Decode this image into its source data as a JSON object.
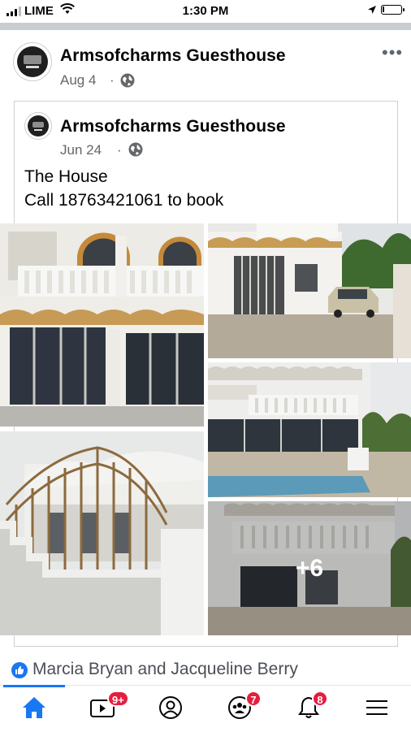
{
  "status_bar": {
    "carrier": "LIME",
    "time": "1:30 PM"
  },
  "post": {
    "page_name": "Armsofcharms Guesthouse",
    "date": "Aug 4",
    "meta_separator": "·",
    "more_menu": "•••"
  },
  "shared_post": {
    "page_name": "Armsofcharms Guesthouse",
    "date": "Jun 24",
    "meta_separator": "·",
    "text_line1": "The House",
    "text_line2": "Call 18763421061 to book",
    "more_photos": "+6"
  },
  "reactions": {
    "names": "Marcia Bryan and Jacqueline Berry"
  },
  "tab_bar": {
    "tabs": [
      {
        "id": "home",
        "icon": "home-icon",
        "badge": "",
        "active": true
      },
      {
        "id": "watch",
        "icon": "video-icon",
        "badge": "9+"
      },
      {
        "id": "profile",
        "icon": "profile-icon",
        "badge": ""
      },
      {
        "id": "groups",
        "icon": "groups-icon",
        "badge": "7"
      },
      {
        "id": "notifications",
        "icon": "bell-icon",
        "badge": "8"
      },
      {
        "id": "menu",
        "icon": "menu-icon",
        "badge": ""
      }
    ]
  },
  "colors": {
    "accent": "#1877f2",
    "badge": "#e41e3f",
    "meta_text": "#65676b"
  }
}
